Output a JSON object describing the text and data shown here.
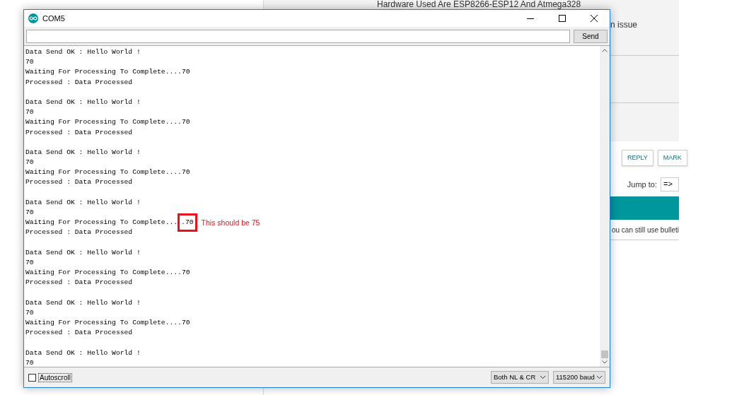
{
  "page": {
    "heading": "Hardware Used Are ESP8266-ESP12 And Atmega328",
    "side_text": "n issue",
    "buttons": [
      "REPLY",
      "MARK"
    ],
    "jump_label": "Jump to:",
    "jump_value": "=>",
    "notice": "ou can still use bulleti"
  },
  "window": {
    "title": "COM5",
    "send_button": "Send",
    "output": [
      [
        {
          "text": "Data Send OK : Hello World !"
        },
        {
          "text": "70"
        },
        {
          "text": "Waiting For Processing To Complete....70"
        },
        {
          "text": "Processed : Data Processed"
        }
      ],
      [
        {
          "text": "Data Send OK : Hello World !"
        },
        {
          "text": "70"
        },
        {
          "text": "Waiting For Processing To Complete....70"
        },
        {
          "text": "Processed : Data Processed"
        }
      ],
      [
        {
          "text": "Data Send OK : Hello World !"
        },
        {
          "text": "70"
        },
        {
          "text": "Waiting For Processing To Complete....70"
        },
        {
          "text": "Processed : Data Processed"
        }
      ],
      [
        {
          "text": "Data Send OK : Hello World !"
        },
        {
          "text": "70"
        },
        {
          "text": "Waiting For Processing To Complete...",
          "boxed": ".70",
          "note": "This should be 75"
        },
        {
          "text": "Processed : Data Processed"
        }
      ],
      [
        {
          "text": "Data Send OK : Hello World !"
        },
        {
          "text": "70"
        },
        {
          "text": "Waiting For Processing To Complete....70"
        },
        {
          "text": "Processed : Data Processed"
        }
      ],
      [
        {
          "text": "Data Send OK : Hello World !"
        },
        {
          "text": "70"
        },
        {
          "text": "Waiting For Processing To Complete....70"
        },
        {
          "text": "Processed : Data Processed"
        }
      ],
      [
        {
          "text": "Data Send OK : Hello World !"
        },
        {
          "text": "70"
        }
      ]
    ],
    "autoscroll": {
      "label": "Autoscroll",
      "checked": false
    },
    "line_ending": "Both NL & CR",
    "baud": "115200 baud"
  }
}
